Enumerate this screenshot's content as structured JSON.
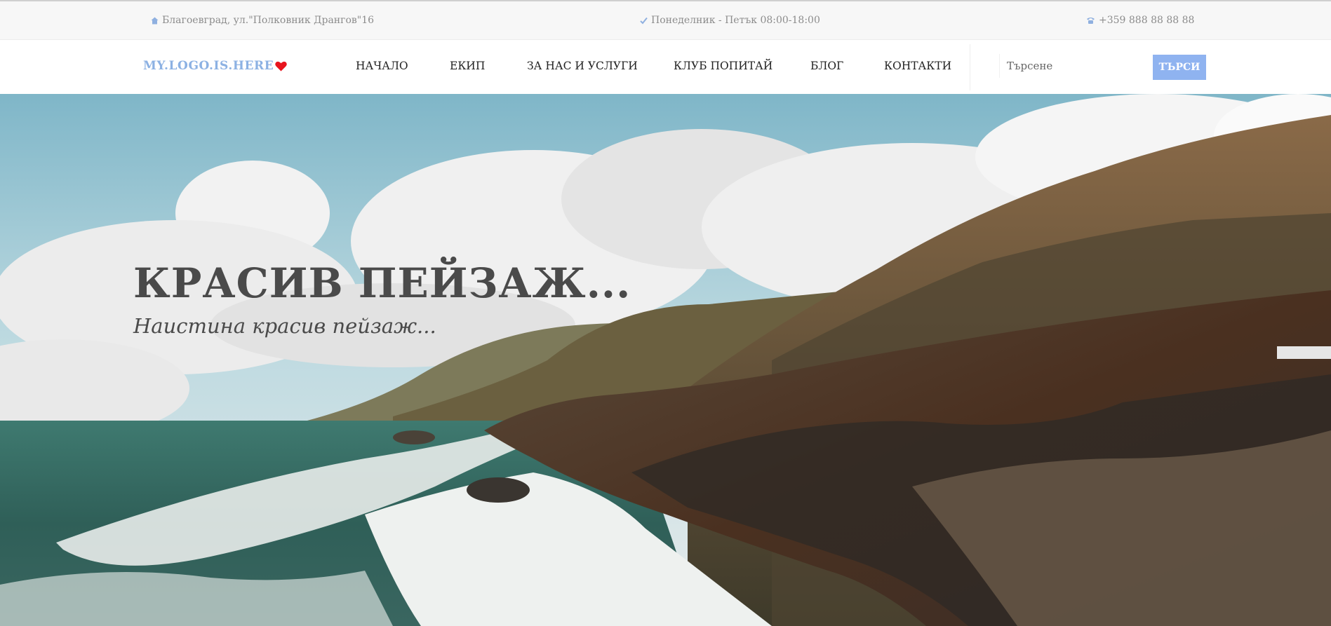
{
  "topbar": {
    "address": "Благоевград, ул.\"Полковник Дрангов\"16",
    "address_icon": "home-icon",
    "hours": "Понеделник - Петък 08:00-18:00",
    "hours_icon": "check-icon",
    "phone": "+359 888 88 88 88",
    "phone_icon": "phone-icon"
  },
  "nav": {
    "logo": "MY.LOGO.IS.HERE",
    "logo_icon": "heart-icon",
    "items": [
      {
        "label": "НАЧАЛО"
      },
      {
        "label": "ЕКИП"
      },
      {
        "label": "ЗА НАС И УСЛУГИ"
      },
      {
        "label": "КЛУБ ПОПИТАЙ"
      },
      {
        "label": "БЛОГ"
      },
      {
        "label": "КОНТАКТИ"
      }
    ],
    "search_placeholder": "Търсене",
    "search_button": "ТЪРСИ"
  },
  "hero": {
    "title": "КРАСИВ ПЕЙЗАЖ...",
    "subtitle": "Наистина красив пейзаж..."
  },
  "colors": {
    "accent": "#8fb3f0",
    "logo": "#8cb1e3",
    "heart": "#e8141e",
    "hero_text": "#4a4a4a"
  }
}
